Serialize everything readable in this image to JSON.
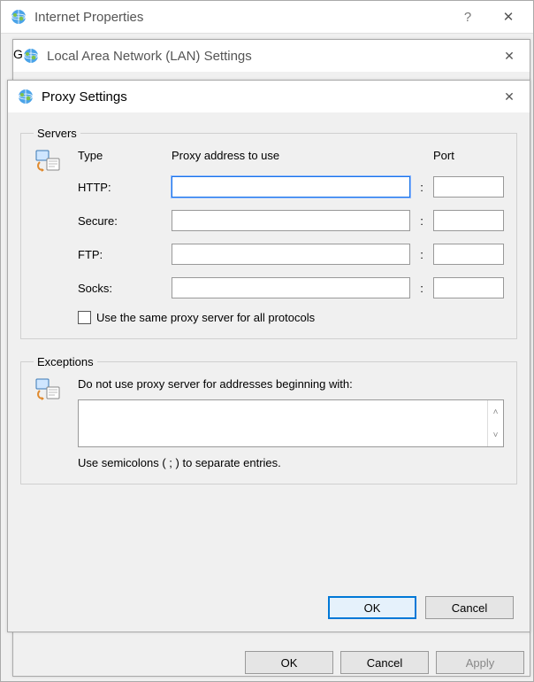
{
  "ip_window": {
    "title": "Internet Properties",
    "help": "?",
    "close": "✕",
    "buttons": {
      "ok": "OK",
      "cancel": "Cancel",
      "apply": "Apply"
    },
    "tab_hint": "G"
  },
  "lan_window": {
    "title": "Local Area Network (LAN) Settings",
    "close": "✕"
  },
  "proxy_window": {
    "title": "Proxy Settings",
    "close": "✕",
    "servers": {
      "legend": "Servers",
      "col_type": "Type",
      "col_addr": "Proxy address to use",
      "col_port": "Port",
      "rows": {
        "http": {
          "label": "HTTP:",
          "addr": "",
          "port": ""
        },
        "secure": {
          "label": "Secure:",
          "addr": "",
          "port": ""
        },
        "ftp": {
          "label": "FTP:",
          "addr": "",
          "port": ""
        },
        "socks": {
          "label": "Socks:",
          "addr": "",
          "port": ""
        }
      },
      "same_proxy": "Use the same proxy server for all protocols"
    },
    "exceptions": {
      "legend": "Exceptions",
      "label": "Do not use proxy server for addresses beginning with:",
      "value": "",
      "hint": "Use semicolons ( ; ) to separate entries."
    },
    "buttons": {
      "ok": "OK",
      "cancel": "Cancel"
    }
  }
}
